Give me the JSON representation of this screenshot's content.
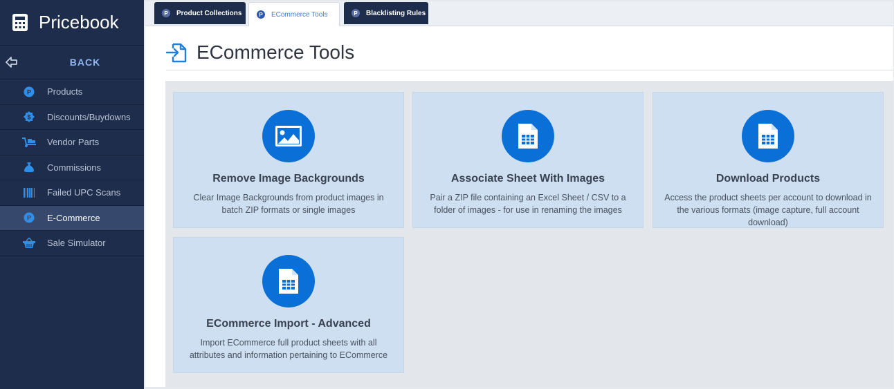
{
  "app": {
    "title": "Pricebook"
  },
  "sidebar": {
    "back_label": "BACK",
    "items": [
      {
        "label": "Products",
        "icon": "p-circle-icon"
      },
      {
        "label": "Discounts/Buydowns",
        "icon": "dollar-tag-icon"
      },
      {
        "label": "Vendor Parts",
        "icon": "hand-truck-icon"
      },
      {
        "label": "Commissions",
        "icon": "money-bag-icon"
      },
      {
        "label": "Failed UPC Scans",
        "icon": "barcode-icon"
      },
      {
        "label": "E-Commerce",
        "icon": "p-circle-icon",
        "active": true
      },
      {
        "label": "Sale Simulator",
        "icon": "basket-icon"
      }
    ]
  },
  "tabs": [
    {
      "label": "Product Collections",
      "badge": "P"
    },
    {
      "label": "ECommerce Tools",
      "badge": "P",
      "active": true
    },
    {
      "label": "Blacklisting Rules",
      "badge": "P"
    }
  ],
  "page": {
    "title": "ECommerce Tools"
  },
  "cards": [
    {
      "title": "Remove Image Backgrounds",
      "description": "Clear Image Backgrounds from product images in batch ZIP formats or single images",
      "icon": "image-icon"
    },
    {
      "title": "Associate Sheet With Images",
      "description": "Pair a ZIP file containing an Excel Sheet / CSV to a folder of images - for use in renaming the images",
      "icon": "spreadsheet-file-icon"
    },
    {
      "title": "Download Products",
      "description": "Access the product sheets per account to download in the various formats (image capture, full account download)",
      "icon": "spreadsheet-file-icon"
    },
    {
      "title": "ECommerce Import - Advanced",
      "description": "Import ECommerce full product sheets with all attributes and information pertaining to ECommerce",
      "icon": "spreadsheet-file-icon"
    }
  ],
  "colors": {
    "sidebar_bg": "#1f2d4c",
    "accent": "#0a6fd6",
    "card_bg": "#cddff0",
    "back_text": "#8fb7ef"
  }
}
